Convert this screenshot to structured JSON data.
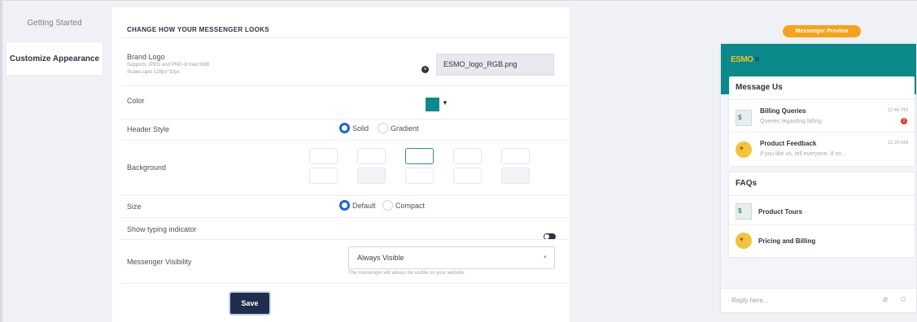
{
  "nav": {
    "items": [
      {
        "label": "Getting Started"
      },
      {
        "label": "Customize Appearance"
      }
    ]
  },
  "settings": {
    "title": "CHANGE HOW YOUR MESSENGER LOOKS",
    "brand_logo": {
      "label": "Brand Logo",
      "help_1": "Supports JPEG and PNG of max 5MB",
      "help_2": "Scales upto 128px*32px",
      "filename": "ESMO_logo_RGB.png"
    },
    "color": {
      "label": "Color",
      "value": "#0a8a8a"
    },
    "header_style": {
      "label": "Header Style",
      "options": [
        "Solid",
        "Gradient"
      ],
      "selected": "Solid"
    },
    "background": {
      "label": "Background",
      "selected_index": 2
    },
    "size": {
      "label": "Size",
      "options": [
        "Default",
        "Compact"
      ],
      "selected": "Default"
    },
    "typing_indicator": {
      "label": "Show typing indicator",
      "enabled": false
    },
    "visibility": {
      "label": "Messenger Visibility",
      "value": "Always Visible",
      "hint": "The messenger will always be visible on your website."
    },
    "save_label": "Save"
  },
  "preview": {
    "badge": "Messenger Preview",
    "logo_text": "ESMO",
    "message_us": {
      "title": "Message Us",
      "items": [
        {
          "title": "Billing Queries",
          "subtitle": "Queries regarding billing",
          "time": "12:46 PM",
          "unread": "2"
        },
        {
          "title": "Product Feedback",
          "subtitle": "If you like us, tell everyone. If no...",
          "time": "11:20 AM"
        }
      ]
    },
    "faqs": {
      "title": "FAQs",
      "items": [
        {
          "title": "Product Tours"
        },
        {
          "title": "Pricing and Billing"
        }
      ]
    },
    "reply_placeholder": "Reply here..."
  },
  "colors": {
    "accent": "#1e63d6",
    "brand": "#0a8a8a",
    "save": "#1f2e4d",
    "badge": "#f7a21b"
  }
}
